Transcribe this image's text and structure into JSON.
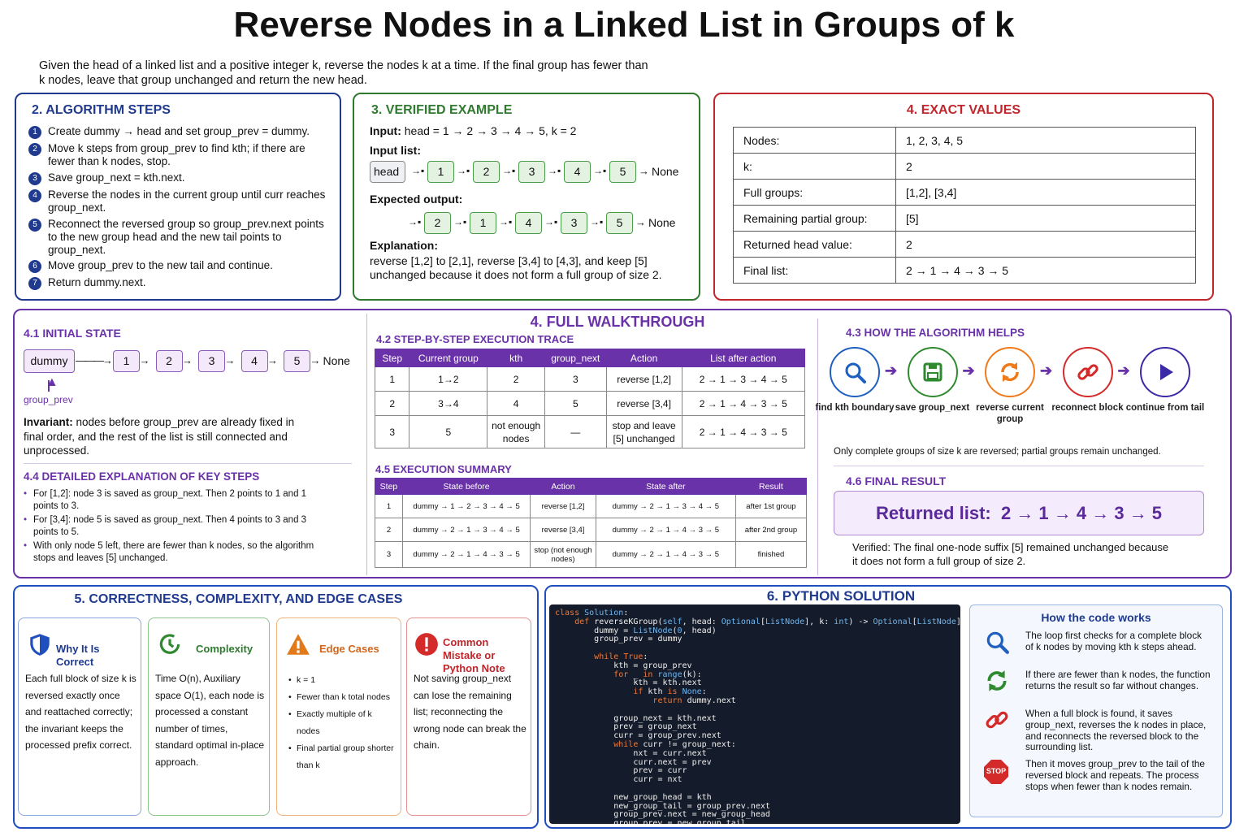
{
  "title": "Reverse Nodes in a Linked List in Groups of k",
  "intro": "Given the head of a linked list and a positive integer k, reverse the nodes k at a time. If the final group has fewer than k nodes, leave that group unchanged and return the new head.",
  "steps": {
    "title": "2. ALGORITHM STEPS",
    "items": [
      {
        "n": "1",
        "text": "Create dummy → head and set group_prev = dummy."
      },
      {
        "n": "2",
        "text": "Move k steps from group_prev to find kth; if there are fewer than k nodes, stop."
      },
      {
        "n": "3",
        "text": "Save group_next = kth.next."
      },
      {
        "n": "4",
        "text": "Reverse the nodes in the current group until curr reaches group_next."
      },
      {
        "n": "5",
        "text": "Reconnect the reversed group so group_prev.next points to the new group head and the new tail points to group_next."
      },
      {
        "n": "6",
        "text": "Move group_prev to the new tail and continue."
      },
      {
        "n": "7",
        "text": "Return dummy.next."
      }
    ]
  },
  "example": {
    "title": "3. VERIFIED EXAMPLE",
    "input_label": "Input:",
    "input_value": "head = 1 → 2 → 3 → 4 → 5, k = 2",
    "input_list_label": "Input list:",
    "head": "head",
    "input_nodes": [
      "1",
      "2",
      "3",
      "4",
      "5"
    ],
    "none": "None",
    "expected_label": "Expected output:",
    "output_nodes": [
      "2",
      "1",
      "4",
      "3",
      "5"
    ],
    "explanation_label": "Explanation:",
    "explanation": "reverse [1,2] to [2,1], reverse [3,4] to [4,3], and keep [5] unchanged because it does not form a full group of size 2."
  },
  "exact": {
    "title": "4. EXACT VALUES",
    "rows": [
      {
        "k": "Nodes:",
        "v": "1, 2, 3, 4, 5"
      },
      {
        "k": "k:",
        "v": "2"
      },
      {
        "k": "Full groups:",
        "v": "[1,2], [3,4]"
      },
      {
        "k": "Remaining partial group:",
        "v": "[5]"
      },
      {
        "k": "Returned head value:",
        "v": "2"
      },
      {
        "k": "Final list:",
        "v": "2 → 1 → 4 → 3 → 5"
      }
    ]
  },
  "walk": {
    "title": "4. FULL WALKTHROUGH",
    "initial_title": "4.1 INITIAL STATE",
    "dummy": "dummy",
    "nodes": [
      "1",
      "2",
      "3",
      "4",
      "5"
    ],
    "none": "None",
    "group_prev": "group_prev",
    "invariant_label": "Invariant:",
    "invariant": " nodes before group_prev are already fixed in final order, and the rest of the list is still connected and unprocessed.",
    "detail_title": "4.4 DETAILED EXPLANATION OF KEY STEPS",
    "details": [
      "For [1,2]: node 3 is saved as group_next. Then 2 points to 1 and 1 points to 3.",
      "For [3,4]: node 5 is saved as group_next. Then 4 points to 3 and 3 points to 5.",
      "With only node 5 left, there are fewer than k nodes, so the algorithm stops and leaves [5] unchanged."
    ],
    "trace_title": "4.2 STEP-BY-STEP EXECUTION TRACE",
    "trace_headers": [
      "Step",
      "Current group",
      "kth",
      "group_next",
      "Action",
      "List after action"
    ],
    "trace_rows": [
      [
        "1",
        "1→2",
        "2",
        "3",
        "reverse [1,2]",
        "2 → 1 → 3 → 4 → 5"
      ],
      [
        "2",
        "3→4",
        "4",
        "5",
        "reverse [3,4]",
        "2 → 1 → 4 → 3 → 5"
      ],
      [
        "3",
        "5",
        "not enough nodes",
        "—",
        "stop and leave [5] unchanged",
        "2 → 1 → 4 → 3 → 5"
      ]
    ],
    "summary_title": "4.5 EXECUTION SUMMARY",
    "summary_headers": [
      "Step",
      "State before",
      "Action",
      "State after",
      "Result"
    ],
    "summary_rows": [
      [
        "1",
        "dummy → 1 → 2 → 3 → 4 → 5",
        "reverse [1,2]",
        "dummy → 2 → 1 → 3 → 4 → 5",
        "after 1st group"
      ],
      [
        "2",
        "dummy → 2 → 1 → 3 → 4 → 5",
        "reverse [3,4]",
        "dummy → 2 → 1 → 4 → 3 → 5",
        "after 2nd group"
      ],
      [
        "3",
        "dummy → 2 → 1 → 4 → 3 → 5",
        "stop (not enough nodes)",
        "dummy → 2 → 1 → 4 → 3 → 5",
        "finished"
      ]
    ],
    "helps_title": "4.3 HOW THE ALGORITHM HELPS",
    "helps": [
      {
        "icon": "search-icon",
        "label": "find kth boundary",
        "color": "#1f5fbf"
      },
      {
        "icon": "save-icon",
        "label": "save group_next",
        "color": "#2f8a2f"
      },
      {
        "icon": "refresh-icon",
        "label": "reverse current group",
        "color": "#f07a1a"
      },
      {
        "icon": "link-icon",
        "label": "reconnect block",
        "color": "#d42a2a"
      },
      {
        "icon": "play-icon",
        "label": "continue from tail",
        "color": "#3a2aa8"
      }
    ],
    "helps_note": "Only complete groups of size k are reversed; partial groups remain unchanged.",
    "final_title": "4.6 FINAL RESULT",
    "final_label": "Returned list:",
    "final_value": "2 → 1 → 4 → 3 → 5",
    "final_note": "Verified: The final one-node suffix [5] remained unchanged because it does not form a full group of size 2."
  },
  "correct": {
    "title": "5. CORRECTNESS, COMPLEXITY, AND EDGE CASES",
    "cards": [
      {
        "title": "Why It Is Correct",
        "icon": "shield-icon",
        "color": "#1f4fbf",
        "body": "Each full block of size k is reversed exactly once and reattached correctly; the invariant keeps the processed prefix correct."
      },
      {
        "title": "Complexity",
        "icon": "clock-icon",
        "color": "#2f8a2f",
        "body": "Time O(n), Auxiliary space O(1), each node is processed a constant number of times, standard optimal in-place approach."
      },
      {
        "title": "Edge Cases",
        "icon": "warning-icon",
        "color": "#e07a1a",
        "items": [
          "k = 1",
          "Fewer than k total nodes",
          "Exactly multiple of k nodes",
          "Final partial group shorter than k"
        ]
      },
      {
        "title": "Common Mistake or Python Note",
        "icon": "alert-icon",
        "color": "#d42a2a",
        "body": "Not saving group_next can lose the remaining list; reconnecting the wrong node can break the chain."
      }
    ]
  },
  "python": {
    "title": "6. PYTHON SOLUTION",
    "code": "class Solution:\n    def reverseKGroup(self, head: Optional[ListNode], k: int) -> Optional[ListNode]:\n        dummy = ListNode(0, head)\n        group_prev = dummy\n\n        while True:\n            kth = group_prev\n            for _ in range(k):\n                kth = kth.next\n                if kth is None:\n                    return dummy.next\n\n            group_next = kth.next\n            prev = group_next\n            curr = group_prev.next\n            while curr != group_next:\n                nxt = curr.next\n                curr.next = prev\n                prev = curr\n                curr = nxt\n\n            new_group_head = kth\n            new_group_tail = group_prev.next\n            group_prev.next = new_group_head\n            group_prev = new_group_tail",
    "how_title": "How the code works",
    "how": [
      {
        "icon": "search-icon",
        "color": "#1f5fbf",
        "text": "The loop first checks for a complete block of k nodes by moving kth k steps ahead."
      },
      {
        "icon": "refresh-icon",
        "color": "#2f8a2f",
        "text": "If there are fewer than k nodes, the function returns the result so far without changes."
      },
      {
        "icon": "link-icon",
        "color": "#d42a2a",
        "text": "When a full block is found, it saves group_next, reverses the k nodes in place, and reconnects the reversed block to the surrounding list."
      },
      {
        "icon": "stop-icon",
        "color": "#d42a2a",
        "text": "Then it moves group_prev to the tail of the reversed block and repeats. The process stops when fewer than k nodes remain."
      }
    ],
    "stop_text": "STOP"
  }
}
